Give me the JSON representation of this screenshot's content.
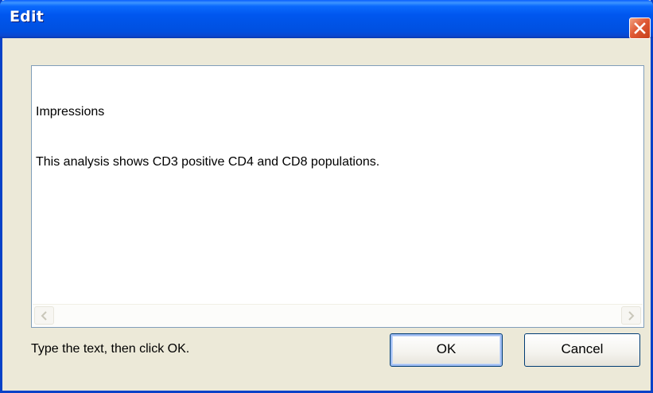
{
  "window": {
    "title": "Edit"
  },
  "editor": {
    "lines": [
      "Impressions",
      "This analysis shows CD3 positive CD4 and CD8 populations."
    ]
  },
  "footer": {
    "hint": "Type the text, then click OK.",
    "ok_label": "OK",
    "cancel_label": "Cancel"
  },
  "icons": {
    "close": "close-icon",
    "scroll_left": "arrow-left-icon",
    "scroll_right": "arrow-right-icon"
  },
  "colors": {
    "titlebar": "#0057ef",
    "close_button": "#e05a35",
    "window_body": "#ece9d8",
    "focus_ring": "#9ebcf2"
  }
}
